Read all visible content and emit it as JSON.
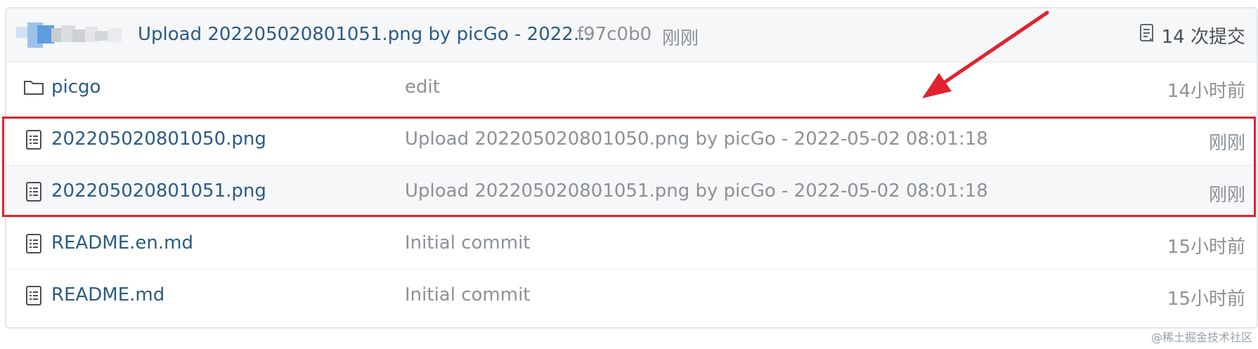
{
  "commit_bar": {
    "message": "Upload 202205020801051.png by picGo - 2022...",
    "sha": "f97c0b0",
    "time": "刚刚",
    "count_label": "14 次提交",
    "count_icon": "history-list-icon"
  },
  "files": [
    {
      "name": "picgo",
      "message": "edit",
      "age": "14小时前",
      "icon": "folder-icon"
    },
    {
      "name": "202205020801050.png",
      "message": "Upload 202205020801050.png by picGo - 2022-05-02 08:01:18",
      "age": "刚刚",
      "icon": "file-icon"
    },
    {
      "name": "202205020801051.png",
      "message": "Upload 202205020801051.png by picGo - 2022-05-02 08:01:18",
      "age": "刚刚",
      "icon": "file-icon"
    },
    {
      "name": "README.en.md",
      "message": "Initial commit",
      "age": "15小时前",
      "icon": "file-icon"
    },
    {
      "name": "README.md",
      "message": "Initial commit",
      "age": "15小时前",
      "icon": "file-icon"
    }
  ],
  "annotation": {
    "highlight_color": "#e0232e",
    "arrow_color": "#e0232e"
  },
  "watermark": "@稀土掘金技术社区",
  "colors": {
    "link": "#2a5b86",
    "muted": "#8c9196",
    "header_bg": "#f6f7f9"
  }
}
